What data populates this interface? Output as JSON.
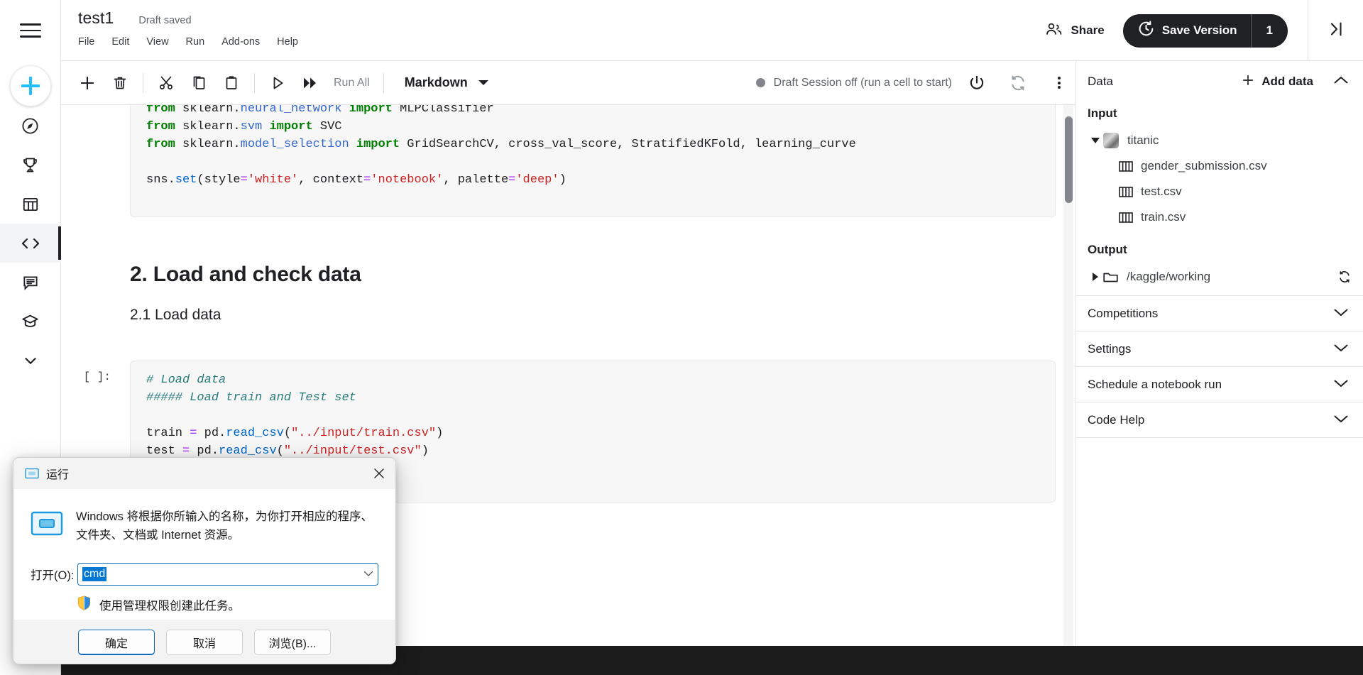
{
  "rail": {
    "hamburger": "menu",
    "create_label": "Create",
    "items": [
      {
        "name": "home-compass",
        "label": "Home"
      },
      {
        "name": "competitions-trophy",
        "label": "Competitions"
      },
      {
        "name": "datasets-table",
        "label": "Datasets"
      },
      {
        "name": "code",
        "label": "Code"
      },
      {
        "name": "discussions",
        "label": "Discussions"
      },
      {
        "name": "learn",
        "label": "Learn"
      },
      {
        "name": "more-chevron",
        "label": "More"
      }
    ]
  },
  "header": {
    "doc_title": "test1",
    "draft_status": "Draft saved",
    "menu": [
      "File",
      "Edit",
      "View",
      "Run",
      "Add-ons",
      "Help"
    ],
    "share_label": "Share",
    "save_version_label": "Save Version",
    "save_version_count": "1"
  },
  "toolbar": {
    "buttons": [
      {
        "name": "add-cell",
        "label": "Add cell"
      },
      {
        "name": "delete-cell",
        "label": "Delete cell"
      },
      {
        "name": "cut-cell",
        "label": "Cut"
      },
      {
        "name": "copy-cell",
        "label": "Copy"
      },
      {
        "name": "paste-cell",
        "label": "Paste"
      },
      {
        "name": "run-cell",
        "label": "Run"
      },
      {
        "name": "run-all",
        "label": "Run All"
      }
    ],
    "run_all_label": "Run All",
    "cell_type": "Markdown",
    "session_status": "Draft Session off (run a cell to start)"
  },
  "notebook": {
    "cell1": {
      "lines": [
        "from sklearn.neural_network import MLPClassifier",
        "from sklearn.svm import SVC",
        "from sklearn.model_selection import GridSearchCV, cross_val_score, StratifiedKFold, learning_curve",
        "",
        "sns.set(style='white', context='notebook', palette='deep')"
      ]
    },
    "markdown1": {
      "h2": "2. Load and check data",
      "h3": "2.1 Load data"
    },
    "cell2": {
      "prompt": "[ ]:",
      "lines": [
        "# Load data",
        "##### Load train and Test set",
        "",
        "train = pd.read_csv(\"../input/train.csv\")",
        "test = pd.read_csv(\"../input/test.csv\")"
      ]
    }
  },
  "right_panel": {
    "title": "Data",
    "add_data_label": "Add data",
    "input_label": "Input",
    "dataset": "titanic",
    "files": [
      "gender_submission.csv",
      "test.csv",
      "train.csv"
    ],
    "output_label": "Output",
    "output_path": "/kaggle/working",
    "accordions": [
      "Competitions",
      "Settings",
      "Schedule a notebook run",
      "Code Help"
    ]
  },
  "run_dialog": {
    "title": "运行",
    "description": "Windows 将根据你所输入的名称，为你打开相应的程序、文件夹、文档或 Internet 资源。",
    "open_label": "打开(O):",
    "input_value": "cmd",
    "admin_note": "使用管理权限创建此任务。",
    "ok_label": "确定",
    "cancel_label": "取消",
    "browse_label": "浏览(B)..."
  },
  "colors": {
    "accent": "#20beff",
    "dark": "#202124",
    "selection_blue": "#0078d4"
  }
}
